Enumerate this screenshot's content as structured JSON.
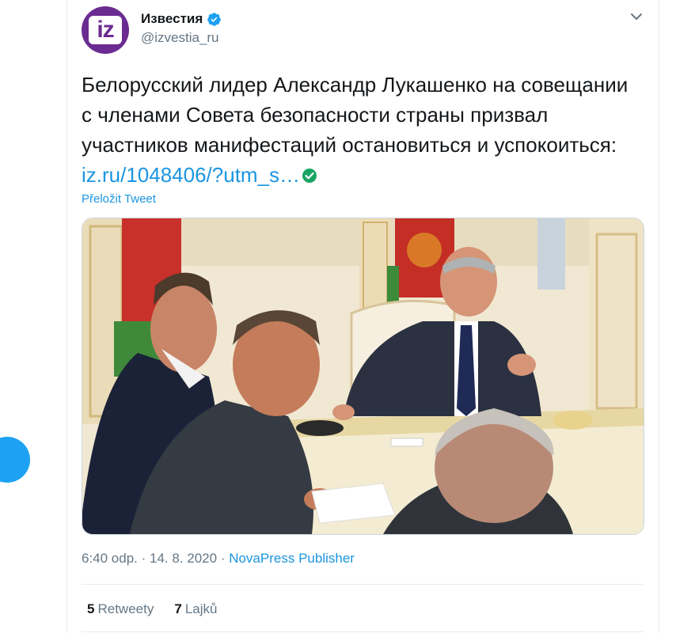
{
  "account": {
    "name": "Известия",
    "handle": "@izvestia_ru",
    "avatar_text": "iz",
    "verified": true
  },
  "tweet": {
    "text_before_link": "Белорусский лидер Александр Лукашенко на совещании с членами Совета безопасности страны призвал участников манифестаций остановиться и успокоиться: ",
    "link": "iz.ru/1048406/?utm_s…",
    "translate_label": "Přeložit Tweet"
  },
  "meta": {
    "time": "6:40 odp.",
    "separator1": " · ",
    "date": "14. 8. 2020",
    "separator2": " · ",
    "source": "NovaPress Publisher"
  },
  "stats": {
    "retweets_count": "5",
    "retweets_label": "Retweety",
    "likes_count": "7",
    "likes_label": "Lajků"
  },
  "colors": {
    "link": "#1b95e0",
    "muted": "#657786",
    "verified": "#1da1f2",
    "avatar_bg": "#6b2c91"
  },
  "icons": [
    "verified-badge-icon",
    "chevron-down-icon",
    "check-circle-icon"
  ]
}
